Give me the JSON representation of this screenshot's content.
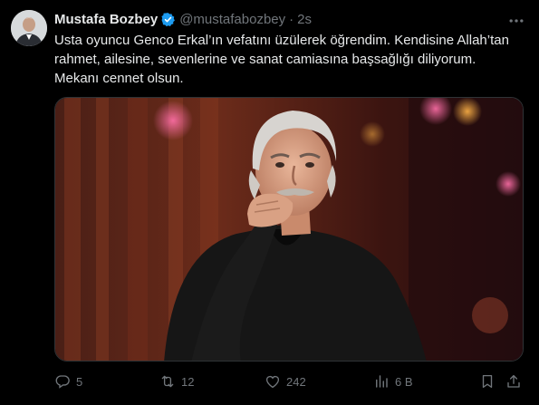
{
  "author": {
    "display_name": "Mustafa Bozbey",
    "handle": "@mustafabozbey",
    "separator": "·",
    "time": "2s",
    "verified": true
  },
  "tweet": {
    "lines": [
      "Usta oyuncu Genco Erkal’ın vefatını üzülerek öğrendim. Kendisine Allah’tan",
      "rahmet, ailesine, sevenlerine ve sanat camiasına başsağlığı diliyorum.",
      "Mekanı cennet olsun."
    ]
  },
  "actions": {
    "replies": "5",
    "retweets": "12",
    "likes": "242",
    "views": "6 B"
  },
  "icons": {
    "more": "more-icon",
    "verified": "verified-badge-icon",
    "reply": "reply-icon",
    "retweet": "retweet-icon",
    "like": "like-icon",
    "views": "views-icon",
    "bookmark": "bookmark-icon",
    "share": "share-icon"
  },
  "colors": {
    "background": "#000000",
    "text": "#e7e9ea",
    "muted": "#71767b",
    "verified": "#1d9bf0"
  }
}
